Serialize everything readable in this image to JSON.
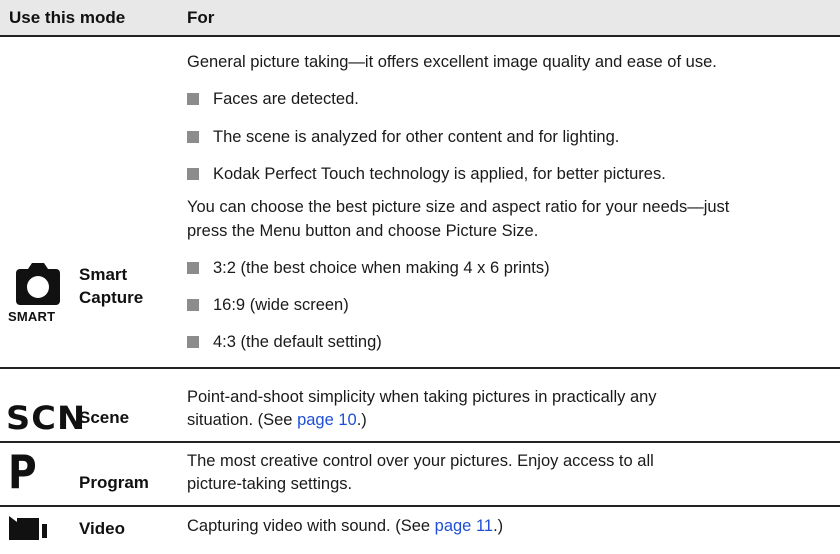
{
  "header": {
    "col1": "Use this mode",
    "col2": "For"
  },
  "rows": {
    "smart": {
      "icon_label": "SMART",
      "name_line1": "Smart",
      "name_line2": "Capture",
      "intro": "General picture taking—it offers excellent image quality and ease of use.",
      "bullets": [
        "Faces are detected.",
        "The scene is analyzed for other content and for lighting.",
        "Kodak Perfect Touch technology is applied, for better pictures."
      ],
      "size_line1": "You can choose the best picture size and aspect ratio for your needs—just",
      "size_line2": "press the Menu button and choose Picture Size.",
      "size_bullets": [
        "3:2 (the best choice when making 4 x 6 prints)",
        "16:9 (wide screen)",
        "4:3 (the default setting)"
      ]
    },
    "scene": {
      "icon_label": "SCN",
      "name": "Scene",
      "line1": "Point-and-shoot simplicity when taking pictures in practically any",
      "line2_pre": "situation. (See ",
      "line2_link": "page 10",
      "line2_post": ".)"
    },
    "program": {
      "icon_label": "P",
      "name": "Program",
      "line1": "The most creative control over your pictures. Enjoy access to all",
      "line2": "picture-taking settings."
    },
    "video": {
      "name": "Video",
      "line_pre": "Capturing video with sound. (See ",
      "line_link": "page 11",
      "line_post": ".)"
    }
  },
  "colors": {
    "link": "#1f4fd6",
    "header_bg": "#e8e8e8",
    "bullet": "#8c8c8c"
  }
}
